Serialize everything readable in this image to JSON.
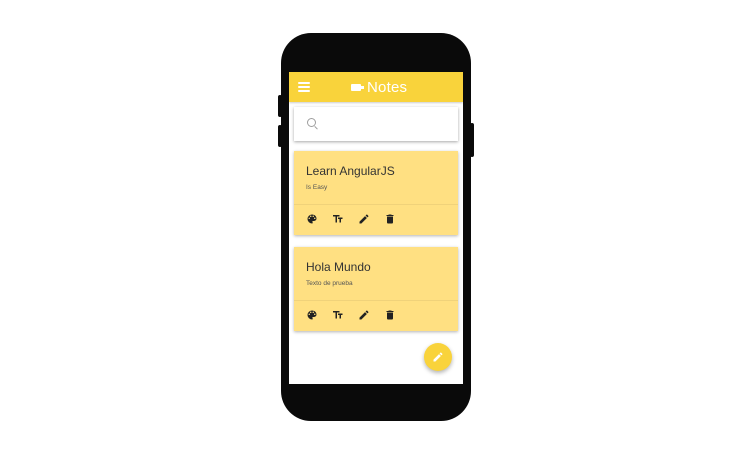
{
  "app": {
    "title": "Notes",
    "accent_color": "#f9d33b",
    "card_color": "#ffe082"
  },
  "search": {
    "icon": "search-icon",
    "placeholder": ""
  },
  "notes": [
    {
      "title": "Learn AngularJS",
      "body": "Is Easy",
      "actions": [
        "palette-icon",
        "text-format-icon",
        "edit-icon",
        "delete-icon"
      ]
    },
    {
      "title": "Hola Mundo",
      "body": "Texto de prueba",
      "actions": [
        "palette-icon",
        "text-format-icon",
        "edit-icon",
        "delete-icon"
      ]
    }
  ],
  "fab": {
    "icon": "edit-icon"
  }
}
